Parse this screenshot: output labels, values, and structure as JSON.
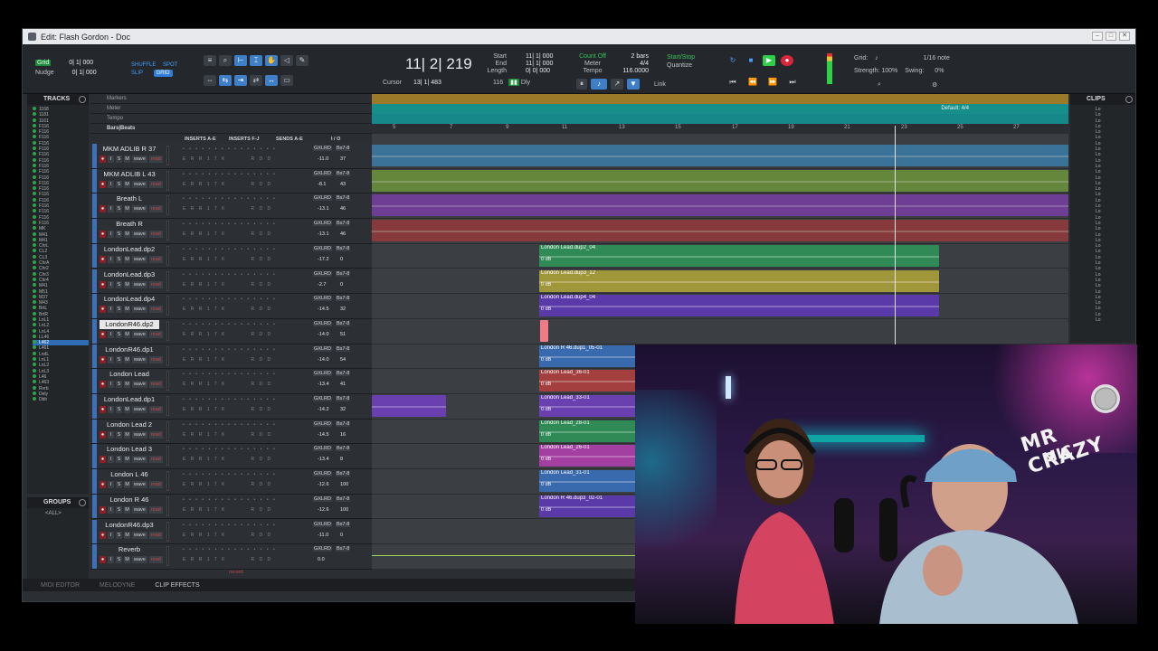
{
  "window": {
    "title": "Edit: Flash Gordon - Doc"
  },
  "toolbar": {
    "grid_label": "Grid",
    "grid_value": "0| 1| 000",
    "nudge_label": "Nudge",
    "nudge_value": "0| 1| 000",
    "modes": [
      "SHUFFLE",
      "SPOT",
      "SLIP",
      "GRID"
    ],
    "counter": "11| 2| 219",
    "cursor_label": "Cursor",
    "cursor_value": "13| 1| 483",
    "start_label": "Start",
    "end_label": "End",
    "length_label": "Length",
    "start_value": "11| 1| 000",
    "end_value": "11| 1| 000",
    "length_value": "0| 0| 000",
    "countoff": "Count Off",
    "meter_label": "Meter",
    "tempo_label": "Tempo",
    "bars": "2 bars",
    "meter_value": "4/4",
    "tempo_value": "116.0000",
    "startstop": "Start/Stop",
    "quantize": "Quantize",
    "link": "Link",
    "dly": "Dly",
    "tempo_small": "116",
    "grid2_label": "Grid:",
    "grid2_value": "1/16 note",
    "strength_label": "Strength:",
    "strength_value": "100%",
    "swing_label": "Swing:",
    "swing_value": "0%"
  },
  "tracks_panel": {
    "title": "TRACKS",
    "items": [
      "1168",
      "1181",
      "1161",
      "F116",
      "F116",
      "F116",
      "F116",
      "F116",
      "F116",
      "F116",
      "F116",
      "F116",
      "F116",
      "F116",
      "F116",
      "F116",
      "F116",
      "F116",
      "F116",
      "F116",
      "F116",
      "MK",
      "M41",
      "M41",
      "ChrL",
      "CL2",
      "CL3",
      "ChrA",
      "Chr2",
      "Chr3",
      "Chr4",
      "M41",
      "M51",
      "M37",
      "M43",
      "BrtL",
      "BrtR",
      "LnL1",
      "LnL2",
      "LnL4",
      "LL46",
      "L462",
      "L461",
      "LndL",
      "LnL1",
      "LnL2",
      "LnL3",
      "L46",
      "L463",
      "Rvrb",
      "Dely",
      "Dblr"
    ],
    "selected_index": 41
  },
  "groups_panel": {
    "title": "GROUPS",
    "item": "<ALL>"
  },
  "rulers": {
    "markers": "Markers",
    "meter": "Meter",
    "tempo": "Tempo",
    "bars": "Bars|Beats"
  },
  "columns": {
    "inserts_ae": "INSERTS A-E",
    "inserts_fj": "INSERTS F-J",
    "sends_ae": "SENDS A-E",
    "io": "I / O"
  },
  "tracks": [
    {
      "name": "MKM ADLIB R 37",
      "vol": "-11.0",
      "pan": "37",
      "color": "#3c7fae",
      "sel": false
    },
    {
      "name": "MKM ADLIB L 43",
      "vol": "-8.1",
      "pan": "43",
      "color": "#6f9a3a",
      "sel": false
    },
    {
      "name": "Breath L",
      "vol": "-13.1",
      "pan": "46",
      "color": "#7a3fa8",
      "sel": false
    },
    {
      "name": "Breath R",
      "vol": "-13.1",
      "pan": "46",
      "color": "#9b3a3a",
      "sel": false
    },
    {
      "name": "LondonLead.dp2",
      "vol": "-17.2",
      "pan": "0",
      "color": "#3c8f5c",
      "sel": false
    },
    {
      "name": "LondonLead.dp3",
      "vol": "-2.7",
      "pan": "0",
      "color": "#a59a3a",
      "sel": false
    },
    {
      "name": "LondonLead.dp4",
      "vol": "-14.5",
      "pan": "32",
      "color": "#6a3fb0",
      "sel": false
    },
    {
      "name": "LondonR46.dp2",
      "vol": "-14.0",
      "pan": "51",
      "color": "#d9434b",
      "sel": true
    },
    {
      "name": "LondonR46.dp1",
      "vol": "-14.0",
      "pan": "54",
      "color": "#3c6fae",
      "sel": false
    },
    {
      "name": "London Lead",
      "vol": "-13.4",
      "pan": "41",
      "color": "#a83f3f",
      "sel": false
    },
    {
      "name": "LondonLead.dp1",
      "vol": "-14.2",
      "pan": "32",
      "color": "#6a3fb0",
      "sel": false
    },
    {
      "name": "London Lead 2",
      "vol": "-14.5",
      "pan": "16",
      "color": "#3c8f5c",
      "sel": false
    },
    {
      "name": "London Lead 3",
      "vol": "-13.4",
      "pan": "8",
      "color": "#a33fa0",
      "sel": false
    },
    {
      "name": "London L 46",
      "vol": "-12.6",
      "pan": "100",
      "color": "#3c7fae",
      "sel": false
    },
    {
      "name": "London R 46",
      "vol": "-12.6",
      "pan": "100",
      "color": "#6a3fb0",
      "sel": false
    },
    {
      "name": "LondonR46.dp3",
      "vol": "-11.0",
      "pan": "0",
      "color": "#3c6fae",
      "sel": false
    },
    {
      "name": "Reverb",
      "vol": "0.0",
      "pan": "",
      "color": "#3f9a3f",
      "sel": false
    }
  ],
  "bar_numbers": [
    "5",
    "7",
    "9",
    "11",
    "13",
    "15",
    "17",
    "19",
    "21",
    "23",
    "25",
    "27",
    "29"
  ],
  "default_meter": "Default: 4/4",
  "clips": [
    {
      "track": 4,
      "label": "London Lead.dup2_04",
      "db": "0 dB",
      "color": "#2f8a55"
    },
    {
      "track": 5,
      "label": "London Lead.dup3_12",
      "db": "0 dB",
      "color": "#a0963a"
    },
    {
      "track": 6,
      "label": "London Lead.dup4_04",
      "db": "0 dB",
      "color": "#5a3aa8"
    },
    {
      "track": 8,
      "label": "London R 46.dup1_05-01",
      "db": "0 dB",
      "color": "#3a6aae"
    },
    {
      "track": 9,
      "label": "London Lead_36-01",
      "db": "0 dB",
      "color": "#a33f3f"
    },
    {
      "track": 10,
      "label": "London Lead_33-01",
      "db": "0 dB",
      "color": "#6a3fb0"
    },
    {
      "track": 11,
      "label": "London Lead_28-01",
      "db": "0 dB",
      "color": "#2f8a55"
    },
    {
      "track": 12,
      "label": "London Lead_26-01",
      "db": "0 dB",
      "color": "#a33fa0"
    },
    {
      "track": 13,
      "label": "London Lead_31-01",
      "db": "0 dB",
      "color": "#3a6aae"
    },
    {
      "track": 14,
      "label": "London R 46.dup3_02-01",
      "db": "0 dB",
      "color": "#5a3aa8"
    }
  ],
  "clips_panel": {
    "title": "CLIPS",
    "items": [
      "Lo",
      "Lo",
      "Lo",
      "Lo",
      "Lo",
      "Lo",
      "Lo",
      "Lo",
      "Lo",
      "Lo",
      "Lo",
      "Lo",
      "Lo",
      "Lo",
      "Lo",
      "Lo",
      "Lo",
      "Lo",
      "Lo",
      "Lo",
      "Lo",
      "Lo",
      "Lo",
      "Lo",
      "Lo",
      "Lo",
      "Lo",
      "Lo",
      "Lo",
      "Lo",
      "Lo",
      "Lo",
      "Lo",
      "Lo",
      "Lo",
      "Lo",
      "Lo",
      "Lo"
    ]
  },
  "bottom_tabs": [
    "MIDI EDITOR",
    "MELODYNE",
    "CLIP EFFECTS"
  ],
  "record_label": "record",
  "webcam": {
    "logo_line1": "MR",
    "logo_line2": "CRAZY",
    "logo_line3": "MIC"
  }
}
